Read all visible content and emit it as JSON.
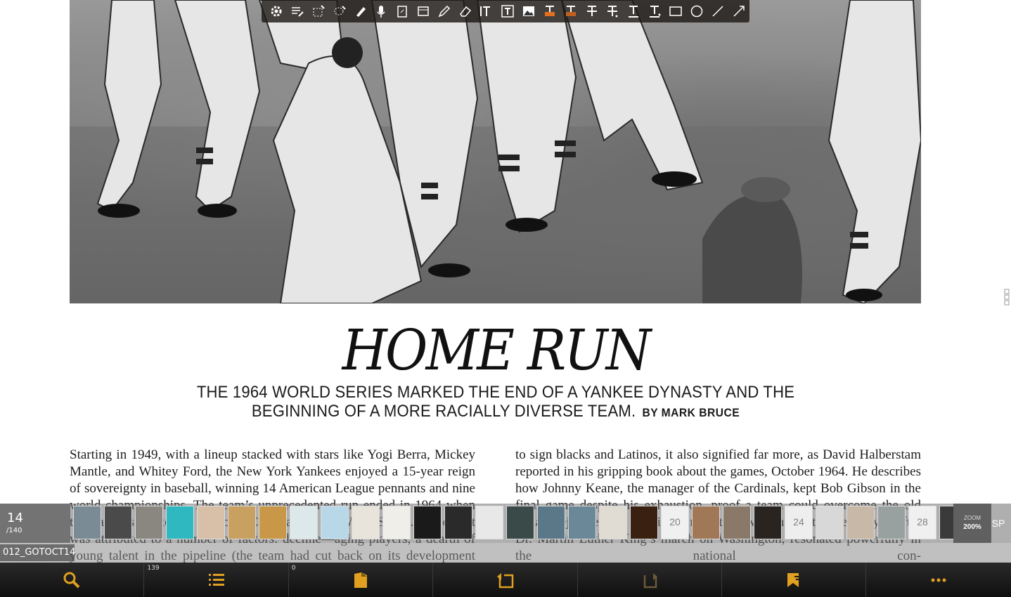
{
  "article": {
    "headline": "HOME RUN",
    "deck": "THE 1964 WORLD SERIES MARKED THE END OF A YANKEE DYNASTY AND THE BEGINNING OF A MORE RACIALLY DIVERSE TEAM.",
    "byline": "BY MARK BRUCE",
    "col_left": "Starting in 1949, with a lineup stacked with stars like Yogi Berra, Mickey Mantle, and Whitey Ford, the New York Yankees enjoyed a 15-year reign of sovereignty in baseball, winning 14 American League pennants and nine world championships. The team’s unprecedented run ended in 1964 when the Yankees fell to the St. Louis Cardinals in the World Series. The defeat was attributed to a number of factors: decline—aging players, a dearth of young talent in the pipeline (the team had cut back on its development programs), and a management reluctant",
    "col_right": "to sign blacks and Latinos, it also signified far more, as David Halberstam reported in his gripping book about the games, October 1964. He describes how Johnny Keane, the manager of the Cardinals, kept Bob Gibson in the final game despite his exhaustion, proof a team could overcome the old racial prejudice. The Cardinals’ milestone win, the first Series played after Dr. Martin Luther King’s march on Washington, resonated powerfully in the national con-"
  },
  "annotation_toolbar": {
    "tools": [
      "settings-icon",
      "list-edit-icon",
      "select-rect-icon",
      "lasso-icon",
      "highlighter-icon",
      "microphone-icon",
      "attach-file-icon",
      "note-icon",
      "pencil-icon",
      "eraser-icon",
      "text-box-icon",
      "text-frame-icon",
      "image-icon",
      "text-highlight-icon",
      "text-highlight-alt-icon",
      "strikethrough-icon",
      "strikethrough-alt-icon",
      "underline-icon",
      "underline-alt-icon",
      "rectangle-icon",
      "ellipse-icon",
      "line-icon",
      "arrow-icon"
    ]
  },
  "page_indicator": {
    "current": "14",
    "total": "/140"
  },
  "thumbnails": [
    {
      "color": "#7a8b95",
      "label": ""
    },
    {
      "color": "#4a4a4a",
      "label": ""
    },
    {
      "color": "#8a8680",
      "label": ""
    },
    {
      "color": "#2fb8c0",
      "label": ""
    },
    {
      "color": "#d8c0a8",
      "label": ""
    },
    {
      "color": "#c8a060",
      "label": ""
    },
    {
      "color": "#c89848",
      "label": ""
    },
    {
      "color": "#dce8ea",
      "label": ""
    },
    {
      "color": "#b8d8e8",
      "label": ""
    },
    {
      "color": "#e8e4dc",
      "label": ""
    },
    {
      "color": "#f0eee8",
      "label": ""
    },
    {
      "color": "#1a1a1a",
      "label": ""
    },
    {
      "color": "#2a2a2a",
      "label": ""
    },
    {
      "color": "#e8e8e8",
      "label": ""
    },
    {
      "color": "#3a4a48",
      "label": ""
    },
    {
      "color": "#5a7888",
      "label": ""
    },
    {
      "color": "#6a8898",
      "label": ""
    },
    {
      "color": "#e0dcd4",
      "label": ""
    },
    {
      "color": "#3a2010",
      "label": ""
    },
    {
      "color": "#f0f0f0",
      "label": "20"
    },
    {
      "color": "#a07858",
      "label": ""
    },
    {
      "color": "#8a7868",
      "label": ""
    },
    {
      "color": "#2a2420",
      "label": ""
    },
    {
      "color": "#eeeeee",
      "label": "24"
    },
    {
      "color": "#d8d8d8",
      "label": ""
    },
    {
      "color": "#c8b8a8",
      "label": ""
    },
    {
      "color": "#98a0a0",
      "label": ""
    },
    {
      "color": "#f0f0f0",
      "label": "28"
    },
    {
      "color": "#3a3a3a",
      "label": ""
    }
  ],
  "zoom": {
    "label": "ZOOM",
    "value": "200%"
  },
  "sp_label": "SP",
  "file_name": "012_GOTOCT14",
  "bottom_nav": [
    {
      "icon": "search-icon",
      "count": ""
    },
    {
      "icon": "list-icon",
      "count": "139"
    },
    {
      "icon": "page-icon",
      "count": "0"
    },
    {
      "icon": "go-back-icon",
      "count": ""
    },
    {
      "icon": "go-forward-icon",
      "count": ""
    },
    {
      "icon": "bookmark-icon",
      "count": ""
    },
    {
      "icon": "more-icon",
      "count": ""
    }
  ],
  "colors": {
    "accent": "#e0a020",
    "nav_bg": "#1a1a1a",
    "toolbar_bg": "#1e1a16"
  }
}
